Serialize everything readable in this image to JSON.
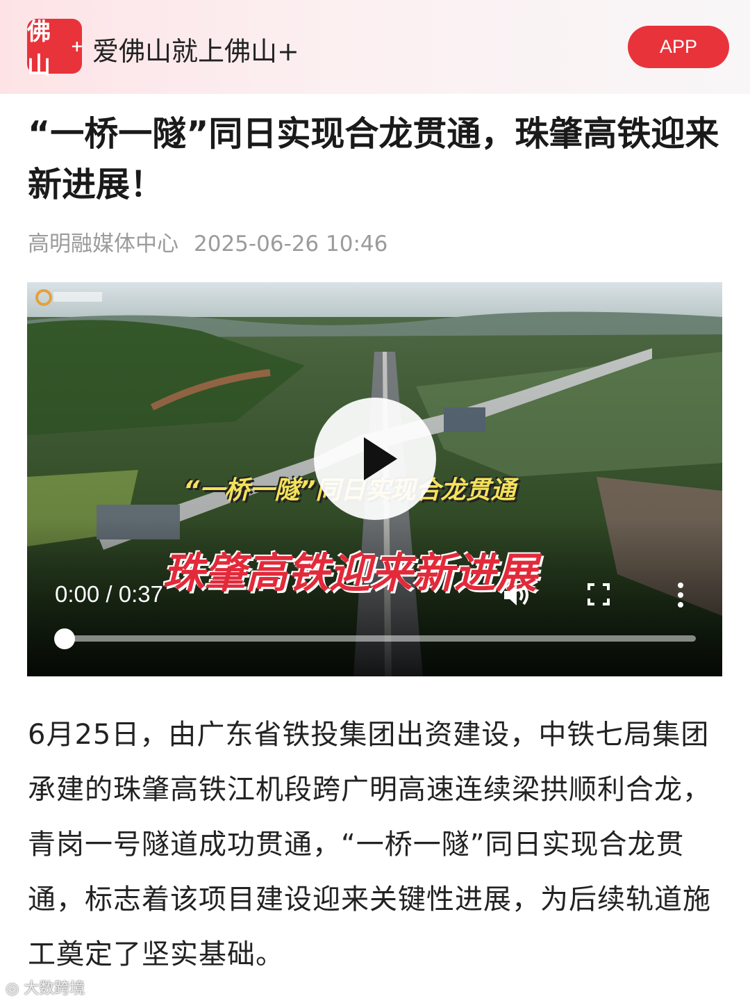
{
  "header": {
    "logo_text": "佛山",
    "logo_plus": "+",
    "brand": "爱佛山就上佛山+",
    "app_button": "APP"
  },
  "article": {
    "title": "“一桥一隧”同日实现合龙贯通，珠肇高铁迎来新进展！",
    "source": "高明融媒体中心",
    "date": "2025-06-26 10:46",
    "body": "6月25日，由广东省铁投集团出资建设，中铁七局集团承建的珠肇高铁江机段跨广明高速连续梁拱顺利合龙，青岗一号隧道成功贯通，“一桥一隧”同日实现合龙贯通，标志着该项目建设迎来关键性进展，为后续轨道施工奠定了坚实基础。"
  },
  "video": {
    "overlay_line1": "“一桥一隧”同日实现合龙贯通",
    "overlay_line2": "珠肇高铁迎来新进展",
    "time_display": "0:00 / 0:37",
    "progress": 0,
    "icons": [
      "play-icon",
      "volume-icon",
      "fullscreen-icon",
      "more-vertical-icon"
    ]
  },
  "watermark": "大数跨境",
  "colors": {
    "accent": "#e8333b",
    "meta": "#9b9b9b",
    "text": "#222222"
  }
}
